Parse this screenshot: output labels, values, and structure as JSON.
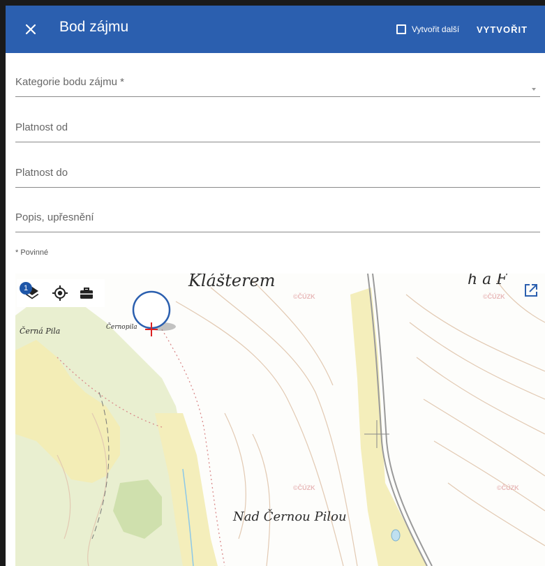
{
  "header": {
    "title": "Bod zájmu",
    "create_another_label": "Vytvořit další",
    "create_button_label": "VYTVOŘIT"
  },
  "form": {
    "category_label": "Kategorie bodu zájmu *",
    "valid_from_label": "Platnost od",
    "valid_to_label": "Platnost do",
    "description_label": "Popis, upřesnění",
    "required_note": "* Povinné"
  },
  "map": {
    "layer_badge_count": "1",
    "labels": {
      "klasterem": "Klášterem",
      "cerna_pila": "Černá Pila",
      "cernopila": "Černopila",
      "nad_cernou_pilou": "Nad Černou Pilou",
      "top_right": "h a F"
    },
    "watermark": "©ČÚZK"
  },
  "colors": {
    "header_bg": "#2b5faf",
    "map_forest": "#f2ecb4",
    "map_meadow": "#dfe8bf",
    "map_contour": "#e2c9b2"
  },
  "icons": {
    "close": "close-icon",
    "layers": "layers-icon",
    "locate": "my-location-icon",
    "tools": "briefcase-icon",
    "open": "open-in-new-icon"
  }
}
